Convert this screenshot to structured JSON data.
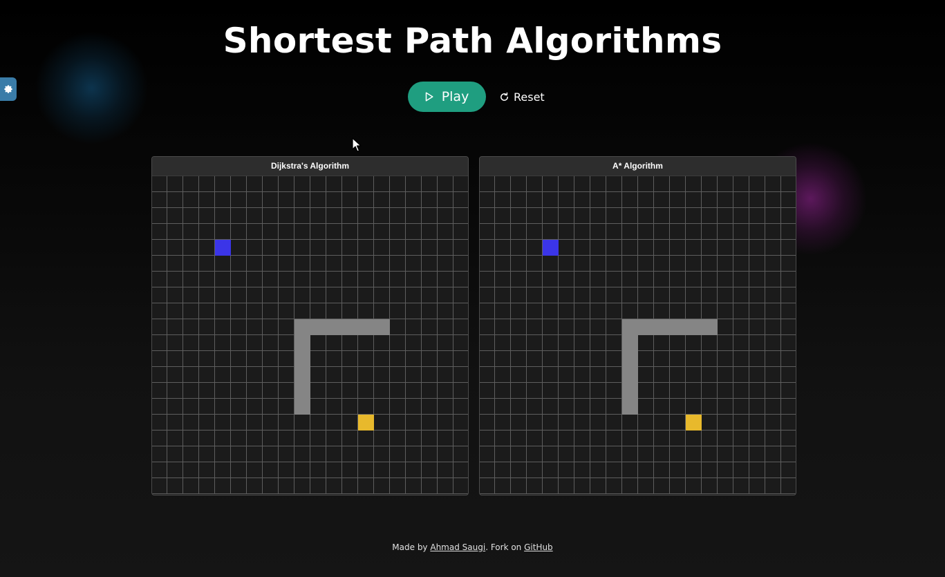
{
  "page": {
    "title": "Shortest Path Algorithms"
  },
  "controls": {
    "play_label": "Play",
    "reset_label": "Reset"
  },
  "settings": {
    "icon": "gear-icon",
    "accent_color": "#3a7ca8"
  },
  "colors": {
    "play_button": "#1f9e80",
    "wall": "#858585",
    "start": "#3b35e8",
    "end": "#e8b92c",
    "grid_line": "#5e5e5e",
    "cell_background": "#1b1b1b"
  },
  "panels": [
    {
      "title": "Dijkstra's Algorithm"
    },
    {
      "title": "A* Algorithm"
    }
  ],
  "grid": {
    "rows": 20,
    "cols": 20,
    "start": [
      4,
      4
    ],
    "end": [
      15,
      13
    ],
    "walls": [
      [
        9,
        9
      ],
      [
        9,
        10
      ],
      [
        9,
        11
      ],
      [
        9,
        12
      ],
      [
        9,
        13
      ],
      [
        9,
        14
      ],
      [
        10,
        9
      ],
      [
        11,
        9
      ],
      [
        12,
        9
      ],
      [
        13,
        9
      ],
      [
        14,
        9
      ]
    ]
  },
  "footer": {
    "prefix": "Made by ",
    "author_link": "Ahmad Saugi",
    "middle": ". Fork on ",
    "github_link": "GitHub"
  }
}
